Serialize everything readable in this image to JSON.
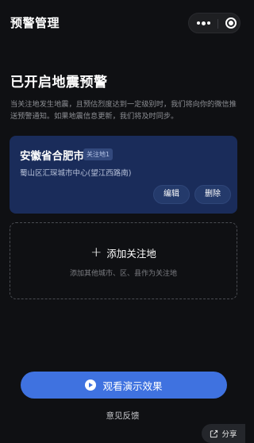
{
  "navbar": {
    "title": "预警管理"
  },
  "heading": "已开启地震预警",
  "description": "当关注地发生地震，且预估烈度达到一定级别时，我们将向你的微信推送预警通知。如果地震信息更新，我们将及时同步。",
  "location_card": {
    "city": "安徽省合肥市",
    "tag": "关注地1",
    "address": "蜀山区汇琛城市中心(望江西路南)",
    "edit_label": "编辑",
    "delete_label": "删除"
  },
  "add_location": {
    "label": "添加关注地",
    "subtitle": "添加其他城市、区、县作为关注地"
  },
  "demo_button": {
    "label": "观看演示效果"
  },
  "feedback_link": "意见反馈",
  "share_button": {
    "label": "分享"
  },
  "colors": {
    "background": "#0f1013",
    "card": "#1a2c5a",
    "accent": "#3f72e0"
  },
  "icons": [
    "more-icon",
    "close-circle-icon",
    "plus-icon",
    "play-icon",
    "share-icon"
  ]
}
